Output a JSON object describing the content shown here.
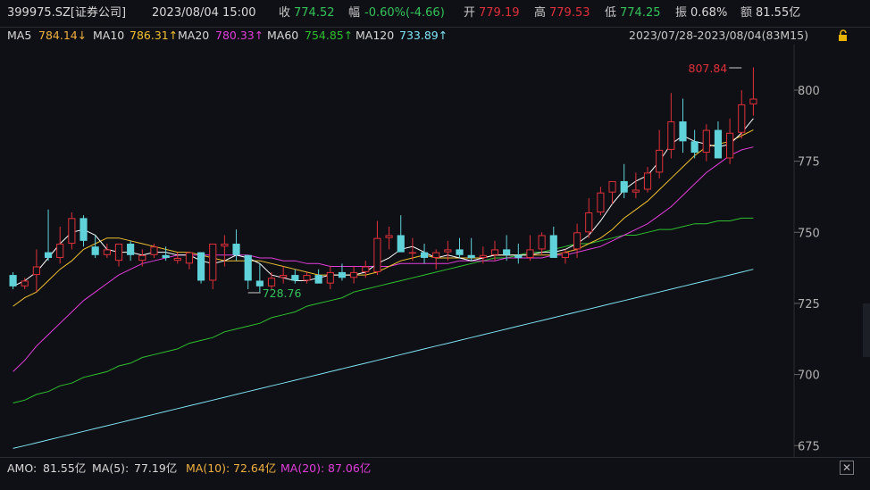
{
  "header": {
    "symbol": "399975.SZ[证券公司]",
    "datetime": "2023/08/04 15:00",
    "close_label": "收",
    "close_value": "774.52",
    "change_label": "幅",
    "change_value": "-0.60%(-4.66)",
    "open_label": "开",
    "open_value": "779.19",
    "high_label": "高",
    "high_value": "779.53",
    "low_label": "低",
    "low_value": "774.25",
    "amplitude_label": "振",
    "amplitude_value": "0.68%",
    "amount_label": "额",
    "amount_value": "81.55亿"
  },
  "ma_bar": {
    "ma5_label": "MA5",
    "ma5_value": "784.14↓",
    "ma10_label": "MA10",
    "ma10_value": "786.31↑",
    "ma20_label": "MA20",
    "ma20_value": "780.33↑",
    "ma60_label": "MA60",
    "ma60_value": "754.85↑",
    "ma120_label": "MA120",
    "ma120_value": "733.89↑",
    "range": "2023/07/28-2023/08/04(83M15)",
    "lock_icon": "lock-icon"
  },
  "footer": {
    "amo_label": "AMO:",
    "amo_value": "81.55亿",
    "ma5_label": "MA(5):",
    "ma5_value": "77.19亿",
    "ma10_label": "MA(10):",
    "ma10_value": "72.64亿",
    "ma20_label": "MA(20):",
    "ma20_value": "87.06亿",
    "close_icon": "✕"
  },
  "colors": {
    "up": "#e0303a",
    "down": "#5fd3d9",
    "ma5": "#ffffff",
    "ma10": "#f0c030",
    "ma20": "#e23ddb",
    "ma60": "#2fbf2f",
    "ma120": "#7fe3f3",
    "label_green": "#34c35a",
    "label_red": "#e0303a"
  },
  "chart_data": {
    "type": "candlestick",
    "y_ticks": [
      675,
      700,
      725,
      750,
      775,
      800
    ],
    "ylim": [
      671,
      816
    ],
    "annotations": [
      {
        "text": "807.84",
        "price": 807.84,
        "candle": 62,
        "kind": "high"
      },
      {
        "text": "728.76",
        "price": 728.76,
        "candle": 20,
        "kind": "low"
      }
    ],
    "candles": [
      [
        735,
        736,
        730,
        731
      ],
      [
        731,
        734,
        730,
        733
      ],
      [
        735,
        744,
        729,
        738
      ],
      [
        743,
        758,
        740,
        741
      ],
      [
        741,
        752,
        739,
        746
      ],
      [
        746,
        757,
        744,
        755
      ],
      [
        755,
        756,
        745,
        747
      ],
      [
        745,
        749,
        741,
        742
      ],
      [
        742,
        746,
        741,
        744
      ],
      [
        740,
        746,
        738,
        746
      ],
      [
        746,
        747,
        740,
        742
      ],
      [
        740,
        744,
        738,
        742
      ],
      [
        742,
        746,
        741,
        745
      ],
      [
        742,
        745,
        740,
        741
      ],
      [
        740,
        743,
        739,
        741
      ],
      [
        739,
        743,
        737,
        743
      ],
      [
        743,
        743,
        732,
        733
      ],
      [
        733,
        745,
        730,
        746
      ],
      [
        745,
        749,
        738,
        746
      ],
      [
        746,
        751,
        740,
        742
      ],
      [
        742,
        741,
        730,
        733
      ],
      [
        733,
        739,
        729,
        731
      ],
      [
        731,
        736,
        730,
        734
      ],
      [
        734,
        738,
        732,
        735
      ],
      [
        735,
        737,
        732,
        733
      ],
      [
        733,
        736,
        732,
        735
      ],
      [
        735,
        737,
        732,
        732
      ],
      [
        732,
        738,
        730,
        736
      ],
      [
        736,
        739,
        733,
        734
      ],
      [
        734,
        738,
        732,
        736
      ],
      [
        736,
        740,
        734,
        738
      ],
      [
        736,
        754,
        735,
        748
      ],
      [
        748,
        752,
        744,
        749
      ],
      [
        749,
        756,
        747,
        743
      ],
      [
        743,
        748,
        740,
        743
      ],
      [
        743,
        746,
        739,
        741
      ],
      [
        741,
        744,
        737,
        743
      ],
      [
        743,
        747,
        740,
        744
      ],
      [
        744,
        748,
        741,
        742
      ],
      [
        742,
        748,
        740,
        741
      ],
      [
        741,
        745,
        739,
        742
      ],
      [
        742,
        747,
        740,
        744
      ],
      [
        744,
        749,
        740,
        742
      ],
      [
        742,
        746,
        739,
        741
      ],
      [
        741,
        749,
        740,
        744
      ],
      [
        744,
        750,
        742,
        749
      ],
      [
        749,
        752,
        745,
        741
      ],
      [
        741,
        744,
        739,
        743
      ],
      [
        744,
        753,
        741,
        750
      ],
      [
        750,
        762,
        748,
        757
      ],
      [
        757,
        766,
        756,
        764
      ],
      [
        764,
        768,
        760,
        768
      ],
      [
        768,
        774,
        762,
        764
      ],
      [
        764,
        771,
        762,
        765
      ],
      [
        765,
        773,
        764,
        771
      ],
      [
        771,
        786,
        769,
        779
      ],
      [
        779,
        799,
        776,
        789
      ],
      [
        789,
        797,
        778,
        782
      ],
      [
        782,
        786,
        776,
        778
      ],
      [
        778,
        788,
        775,
        786
      ],
      [
        786,
        789,
        780,
        776
      ],
      [
        776,
        790,
        774,
        785
      ],
      [
        785,
        800,
        783,
        795
      ],
      [
        795,
        808,
        791,
        797
      ]
    ]
  },
  "chart_lines": {
    "ma5": [
      731,
      733,
      736,
      741,
      746,
      750,
      751,
      749,
      744,
      743,
      743,
      742,
      743,
      743,
      742,
      742,
      740,
      739,
      740,
      742,
      741,
      739,
      735,
      734,
      733,
      733,
      734,
      735,
      735,
      735,
      736,
      739,
      741,
      744,
      745,
      743,
      741,
      742,
      741,
      740,
      741,
      742,
      742,
      742,
      742,
      743,
      743,
      744,
      746,
      749,
      754,
      760,
      765,
      768,
      770,
      775,
      781,
      784,
      782,
      781,
      780,
      781,
      785,
      790
    ],
    "ma10": [
      724,
      727,
      729,
      733,
      737,
      740,
      744,
      746,
      748,
      748,
      747,
      746,
      745,
      744,
      743,
      743,
      742,
      741,
      740,
      740,
      740,
      740,
      739,
      738,
      737,
      736,
      735,
      735,
      735,
      735,
      735,
      736,
      738,
      740,
      741,
      742,
      741,
      741,
      741,
      741,
      741,
      742,
      742,
      742,
      742,
      742,
      742,
      743,
      744,
      746,
      748,
      751,
      755,
      758,
      761,
      765,
      769,
      773,
      777,
      780,
      781,
      782,
      784,
      786
    ],
    "ma20": [
      701,
      705,
      710,
      714,
      718,
      722,
      726,
      729,
      732,
      735,
      737,
      739,
      740,
      741,
      742,
      742,
      742,
      742,
      742,
      742,
      742,
      741,
      741,
      740,
      740,
      739,
      739,
      738,
      738,
      738,
      738,
      738,
      738,
      739,
      739,
      739,
      739,
      739,
      740,
      740,
      740,
      740,
      741,
      741,
      741,
      741,
      742,
      742,
      743,
      744,
      745,
      747,
      749,
      751,
      753,
      756,
      759,
      763,
      767,
      771,
      774,
      777,
      779,
      780
    ],
    "ma60": [
      690,
      691,
      693,
      694,
      696,
      697,
      699,
      700,
      701,
      703,
      704,
      706,
      707,
      708,
      709,
      711,
      712,
      713,
      715,
      716,
      717,
      718,
      720,
      721,
      722,
      724,
      725,
      726,
      727,
      729,
      730,
      731,
      732,
      733,
      734,
      735,
      736,
      737,
      738,
      739,
      740,
      741,
      741,
      742,
      743,
      743,
      744,
      745,
      746,
      746,
      747,
      748,
      749,
      749,
      750,
      751,
      751,
      752,
      753,
      753,
      754,
      754,
      755,
      755
    ],
    "ma120": [
      674,
      675,
      676,
      677,
      678,
      679,
      680,
      681,
      682,
      683,
      684,
      685,
      686,
      687,
      688,
      689,
      690,
      691,
      692,
      693,
      694,
      695,
      696,
      697,
      698,
      699,
      700,
      701,
      702,
      703,
      704,
      705,
      706,
      707,
      708,
      709,
      710,
      711,
      712,
      713,
      714,
      715,
      716,
      717,
      718,
      719,
      720,
      721,
      722,
      723,
      724,
      725,
      726,
      727,
      728,
      729,
      730,
      731,
      732,
      733,
      734,
      735,
      736,
      737
    ]
  }
}
